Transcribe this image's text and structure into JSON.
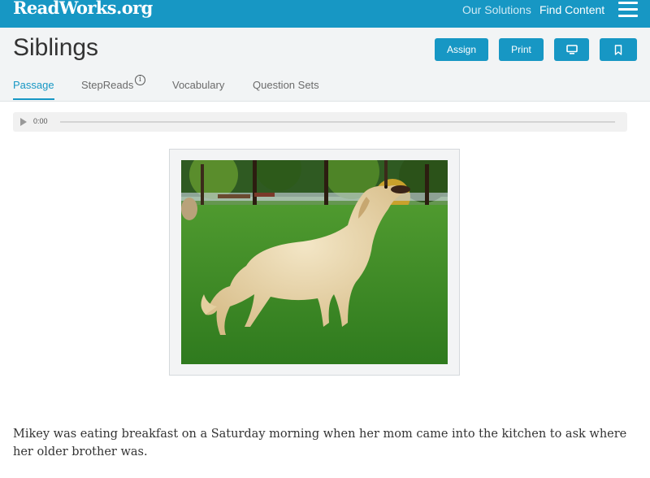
{
  "brand": {
    "logo_text": "ReadWorks.org",
    "accent_color": "#1797c4"
  },
  "nav": {
    "solutions_label": "Our Solutions",
    "find_content_label": "Find Content",
    "menu_icon": "hamburger-menu-icon"
  },
  "passage": {
    "title": "Siblings",
    "actions": {
      "assign_label": "Assign",
      "print_label": "Print",
      "present_icon": "monitor-icon",
      "bookmark_icon": "bookmark-icon"
    },
    "tabs": [
      "Passage",
      "StepReads",
      "Vocabulary",
      "Question Sets"
    ],
    "active_tab": "Passage"
  },
  "audio": {
    "time": "0:00",
    "play_icon": "play-icon"
  },
  "image": {
    "subject": "golden retriever standing in park grass"
  },
  "story": {
    "paragraph_1": "Mikey was eating breakfast on a Saturday morning when her mom came into the kitchen to ask where her older brother was."
  }
}
